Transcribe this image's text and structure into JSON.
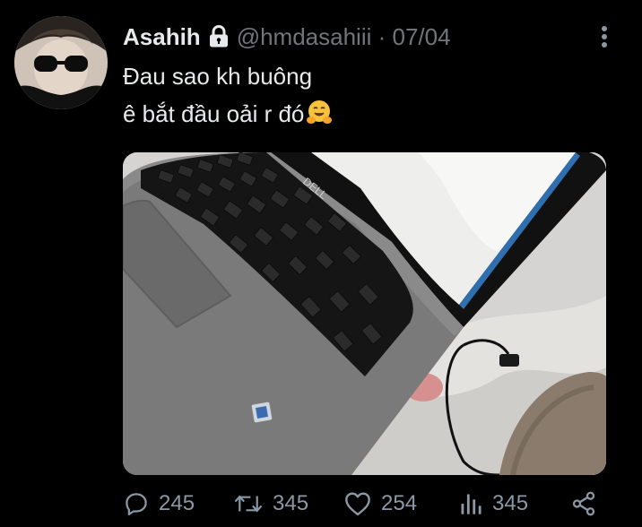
{
  "author": {
    "display_name": "Asahih",
    "handle": "@hmdasahiii",
    "separator": "·",
    "date": "07/04",
    "protected_icon": "lock-icon"
  },
  "tweet": {
    "lines": [
      "Đau sao kh buông",
      "ê bắt đầu oải r đó"
    ],
    "emoji_icon": "hugging-face-emoji"
  },
  "media": {
    "description_icon": "laptop-photo"
  },
  "actions": {
    "replies": "245",
    "retweets": "345",
    "likes": "254",
    "views": "345"
  },
  "colors": {
    "background": "#000000",
    "text_primary": "#e7e9ea",
    "text_secondary": "#71767b",
    "action_gray": "#8b98a5"
  }
}
